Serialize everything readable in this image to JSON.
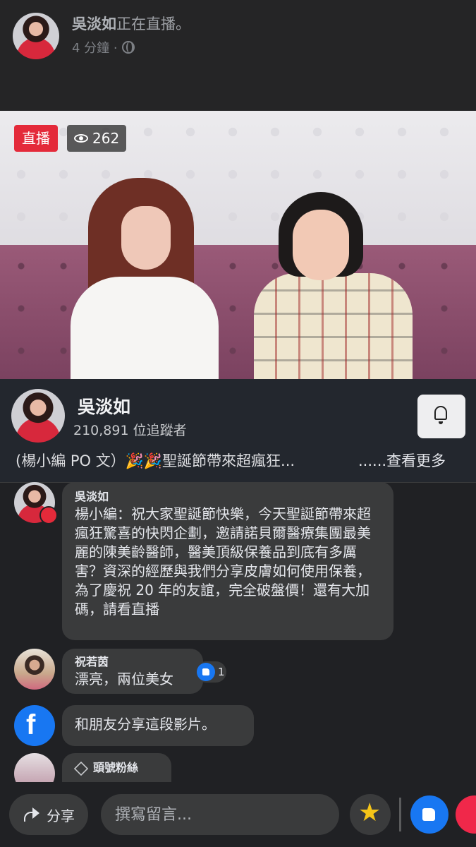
{
  "post_header": {
    "author": "吳淡如",
    "status": "正在直播。",
    "time": "4 分鐘 ·",
    "privacy_icon": "globe-icon"
  },
  "video": {
    "live_label": "直播",
    "viewer_count": "262",
    "viewer_icon": "eye-icon"
  },
  "page_info": {
    "name": "吳淡如",
    "followers": "210,891 位追蹤者",
    "description": "(楊小編 PO 文）🎉🎉聖誕節帶來超瘋狂...",
    "see_more": "......查看更多",
    "bell_icon": "bell-icon"
  },
  "comments": [
    {
      "author": "吳淡如",
      "text": "楊小編：祝大家聖誕節快樂，今天聖誕節帶來超瘋狂驚喜的快閃企劃，邀請諾貝爾醫療集團最美麗的陳美齡醫師，醫美頂級保養品到底有多厲害？資深的經歷與我們分享皮膚如何使用保養，為了慶祝 20 年的友誼，完全破盤價！還有大加碼，請看直播"
    },
    {
      "author": "祝若茵",
      "text": "漂亮，兩位美女",
      "reaction_count": "1"
    },
    {
      "text": "和朋友分享這段影片。"
    },
    {
      "author": "頭號粉絲"
    }
  ],
  "bottom_bar": {
    "share_label": "分享",
    "comment_placeholder": "撰寫留言..."
  },
  "colors": {
    "live_red": "#e42a3a",
    "facebook_blue": "#1877f2",
    "love_red": "#f0284a"
  }
}
